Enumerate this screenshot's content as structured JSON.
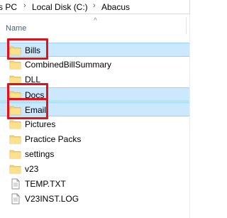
{
  "breadcrumb": {
    "items": [
      "s PC",
      "Local Disk (C:)",
      "Abacus"
    ],
    "separator": "›"
  },
  "header": {
    "name_label": "Name",
    "sort_glyph": "^"
  },
  "files": [
    {
      "name": "Bills",
      "type": "folder",
      "selected": true,
      "highlighted": true
    },
    {
      "name": "CombinedBillSummary",
      "type": "folder",
      "selected": false,
      "highlighted": false
    },
    {
      "name": "DLL",
      "type": "folder",
      "selected": false,
      "highlighted": false
    },
    {
      "name": "Docs",
      "type": "folder",
      "selected": true,
      "highlighted": true
    },
    {
      "name": "Email",
      "type": "folder",
      "selected": true,
      "highlighted": true
    },
    {
      "name": "Pictures",
      "type": "folder",
      "selected": false,
      "highlighted": false
    },
    {
      "name": "Practice Packs",
      "type": "folder",
      "selected": false,
      "highlighted": false
    },
    {
      "name": "settings",
      "type": "folder",
      "selected": false,
      "highlighted": false
    },
    {
      "name": "v23",
      "type": "folder",
      "selected": false,
      "highlighted": false
    },
    {
      "name": "TEMP.TXT",
      "type": "text-file",
      "selected": false,
      "highlighted": false
    },
    {
      "name": "V23INST.LOG",
      "type": "text-file",
      "selected": false,
      "highlighted": false
    }
  ],
  "colors": {
    "selection": "#cce8ff",
    "selection_border": "#99d1ff",
    "annotation": "#e2111b",
    "folder": "#f8d775",
    "header_text": "#4c607a"
  },
  "icons": {
    "folder": "folder-icon",
    "text-file": "text-file-icon"
  }
}
